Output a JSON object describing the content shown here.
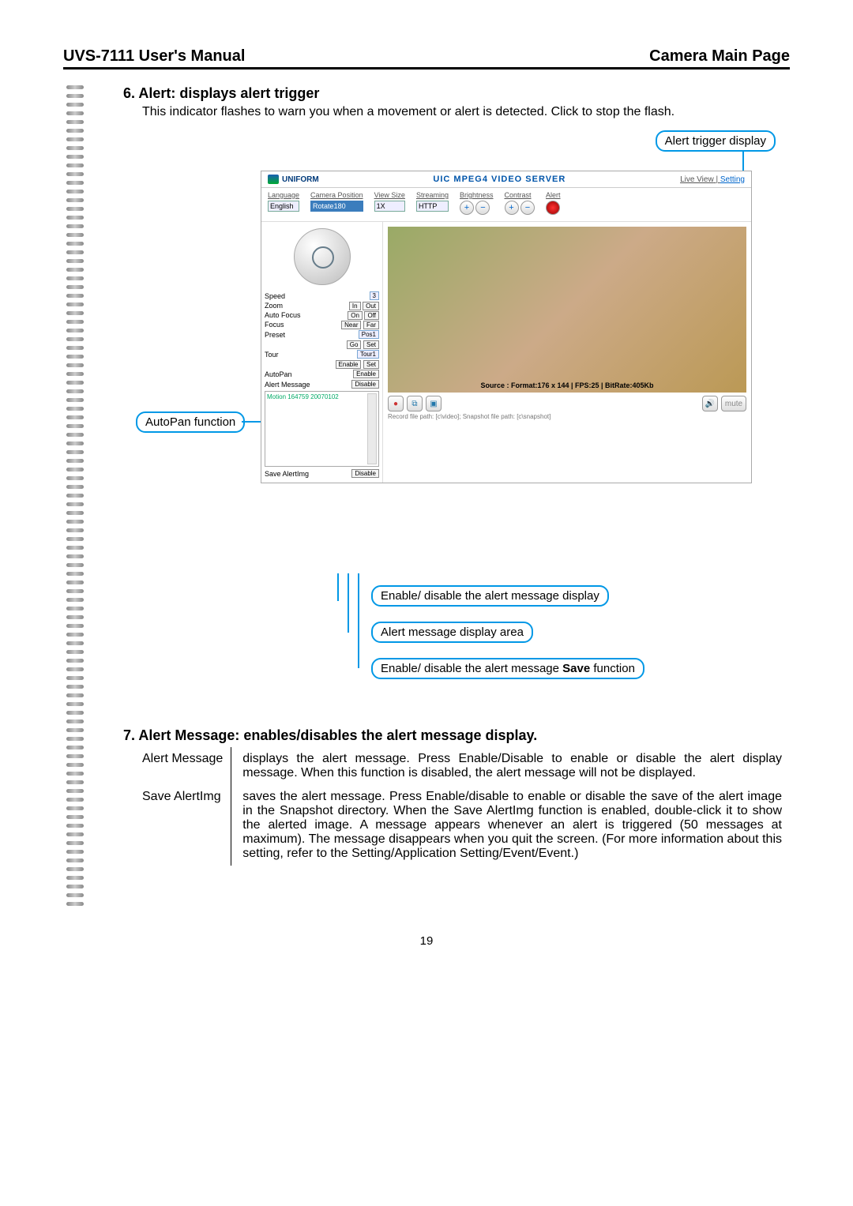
{
  "header": {
    "left": "UVS-7111 User's Manual",
    "right": "Camera Main Page"
  },
  "sec6": {
    "title": "6.  Alert: displays alert trigger",
    "body": "This indicator flashes to warn you when a movement or alert is detected. Click to stop the flash."
  },
  "callouts": {
    "alert_trigger": "Alert trigger display",
    "autopan": "AutoPan function",
    "enable_msg": "Enable/ disable the alert message display",
    "msg_area": "Alert message display area",
    "save_func": "Enable/ disable the alert message Save function"
  },
  "app": {
    "logo_text": "UNIFORM",
    "title": "UIC MPEG4 VIDEO SERVER",
    "link_live": "Live View",
    "link_setting": "Setting",
    "link_sep": " | ",
    "toolbar": {
      "language": "Language",
      "language_v": "English",
      "camera_pos": "Camera Position",
      "camera_pos_v": "Rotate180",
      "view_size": "View Size",
      "view_size_v": "1X",
      "streaming": "Streaming",
      "streaming_v": "HTTP",
      "brightness": "Brightness",
      "contrast": "Contrast",
      "alert": "Alert"
    },
    "ptz": {
      "speed": "Speed",
      "speed_v": "3",
      "zoom": "Zoom",
      "zoom_in": "In",
      "zoom_out": "Out",
      "autofocus": "Auto Focus",
      "af_on": "On",
      "af_off": "Off",
      "focus": "Focus",
      "focus_near": "Near",
      "focus_far": "Far",
      "preset": "Preset",
      "preset_v": "Pos1",
      "go": "Go",
      "set": "Set",
      "tour": "Tour",
      "tour_v": "Tour1",
      "enable": "Enable",
      "autopan": "AutoPan",
      "autopan_btn": "Enable",
      "alertmsg": "Alert Message",
      "alertmsg_btn": "Disable",
      "msg_sample": "Motion 164759 20070102",
      "savealert": "Save AlertImg",
      "savealert_btn": "Disable"
    },
    "video_info": "Source : Format:176 x 144 | FPS:25 | BitRate:405Kb",
    "pathline": "Record file path: [c\\video]; Snapshot file path: [c\\snapshot]"
  },
  "sec7": {
    "title": "7.  Alert Message: enables/disables the alert message display.",
    "rows": [
      {
        "k": "Alert Message",
        "v": "displays the alert message. Press Enable/Disable to enable or disable the alert display message. When this function is disabled, the alert message will not be displayed."
      },
      {
        "k": "Save AlertImg",
        "v": "saves the alert message. Press Enable/disable to enable or disable the save of the alert image in the Snapshot directory. When the Save AlertImg function is enabled, double-click it to show the alerted image. A message appears whenever an alert is triggered (50 messages at maximum). The message disappears when you quit the screen. (For more information about this setting, refer to the Setting/Application Setting/Event/Event.)"
      }
    ]
  },
  "page_number": "19"
}
